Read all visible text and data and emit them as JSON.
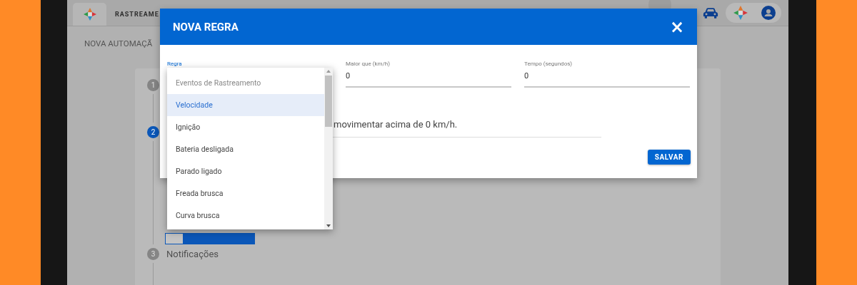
{
  "top_bar": {
    "tabs": [
      {
        "kind": "logo",
        "selected": true
      },
      {
        "kind": "text",
        "label": "RASTREAME",
        "selected": false
      }
    ]
  },
  "page_title": "NOVA AUTOMAÇÃ",
  "stepper": {
    "steps": [
      {
        "number": "1",
        "active": false
      },
      {
        "number": "2",
        "active": true
      },
      {
        "number": "3",
        "label": "Notificações",
        "active": false
      }
    ]
  },
  "dialog": {
    "title": "NOVA REGRA",
    "close": "×",
    "fields": [
      {
        "kind": "select",
        "label": "Regra"
      },
      {
        "kind": "input",
        "label": "Maior que (km/h)",
        "value": "0"
      },
      {
        "kind": "input",
        "label": "Tempo (segundos)",
        "value": "0"
      }
    ],
    "description": "movimentar acima de 0 km/h.",
    "save_button": "SALVAR"
  },
  "dropdown": {
    "items": [
      {
        "label": "Eventos de Rastreamento",
        "kind": "header",
        "selected": false
      },
      {
        "label": "Velocidade",
        "kind": "option",
        "selected": true
      },
      {
        "label": "Ignição",
        "kind": "option",
        "selected": false
      },
      {
        "label": "Bateria desligada",
        "kind": "option",
        "selected": false
      },
      {
        "label": "Parado ligado",
        "kind": "option",
        "selected": false
      },
      {
        "label": "Freada brusca",
        "kind": "option",
        "selected": false
      },
      {
        "label": "Curva brusca",
        "kind": "option",
        "selected": false
      }
    ]
  }
}
